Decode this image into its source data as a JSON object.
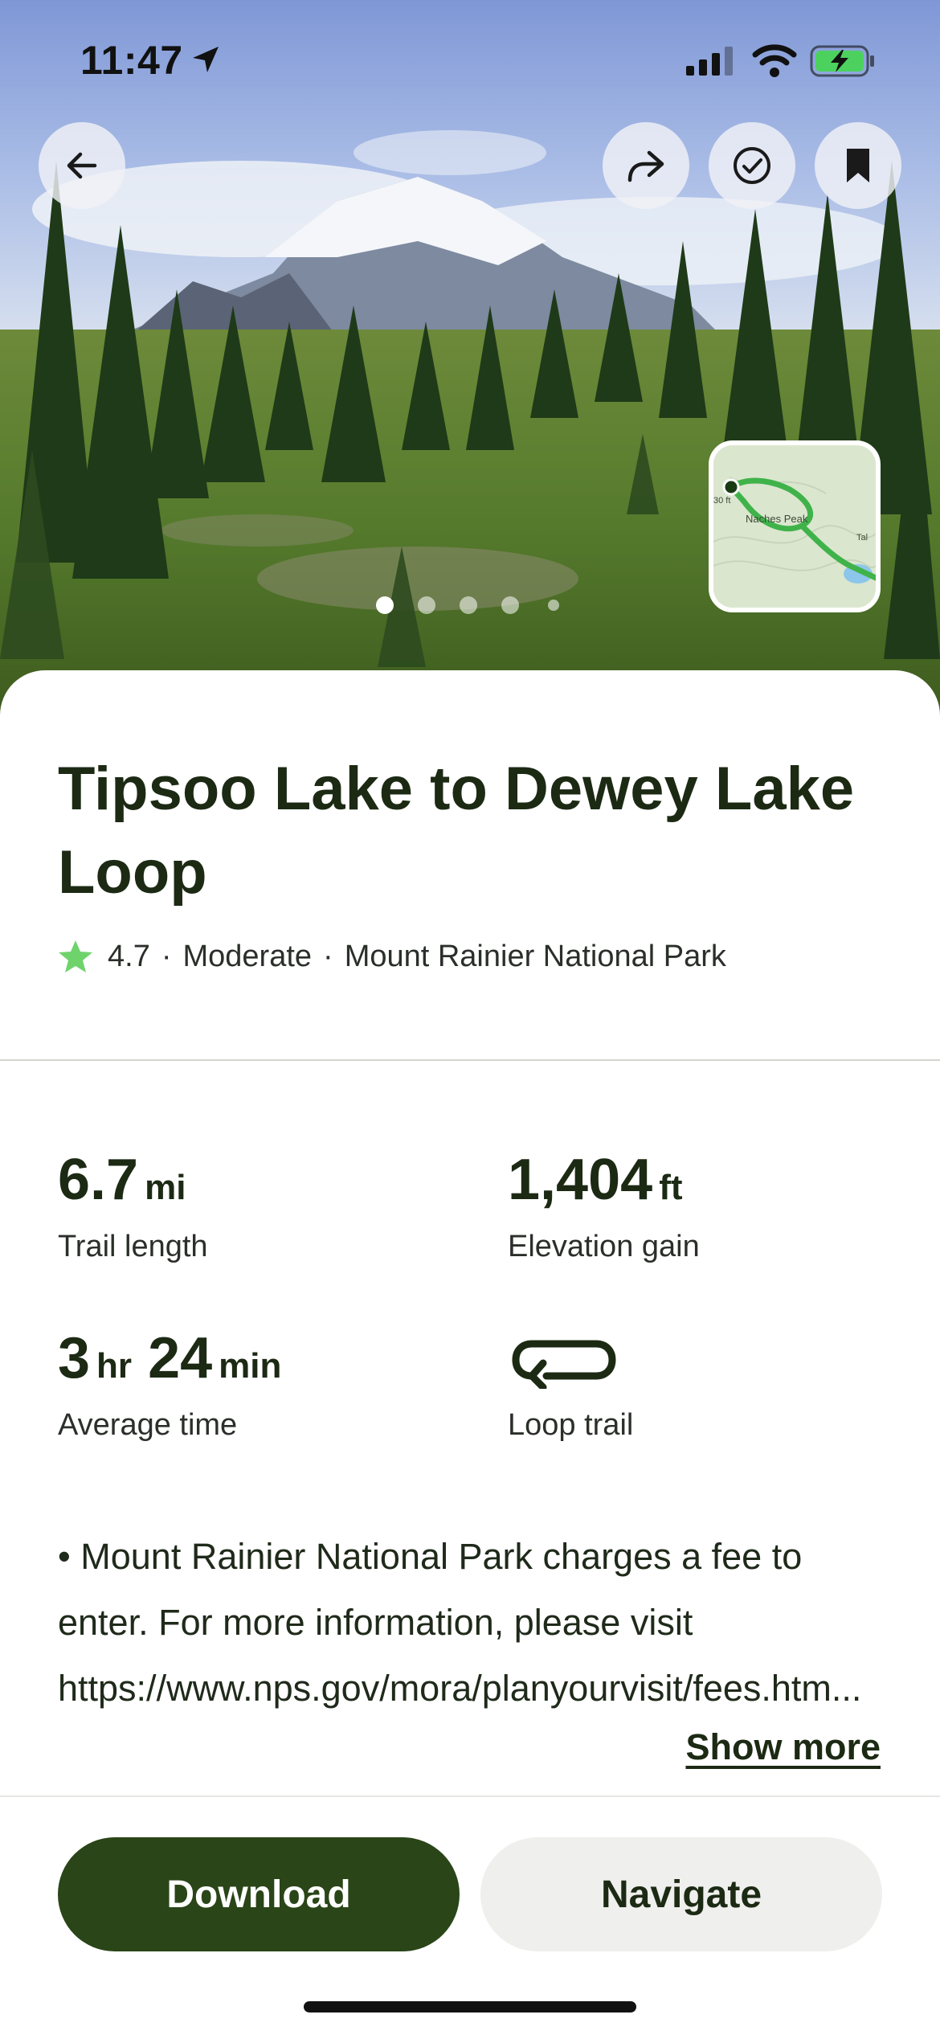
{
  "status_bar": {
    "time": "11:47",
    "icons": [
      "location-arrow-icon",
      "cellular-signal-icon",
      "wifi-icon",
      "battery-charging-icon"
    ]
  },
  "hero": {
    "photo_description_icon": "mountain-photo",
    "photo_count": 5,
    "active_photo_index": 0,
    "buttons": {
      "back": "back-arrow-icon",
      "share": "share-icon",
      "complete": "checkmark-circle-icon",
      "save": "bookmark-icon"
    },
    "map_thumbnail": {
      "label": "Naches Peak",
      "elevation_label": "30 ft",
      "side_label": "Tal"
    }
  },
  "trail": {
    "title": "Tipsoo Lake to Dewey Lake Loop",
    "rating": "4.7",
    "difficulty": "Moderate",
    "park": "Mount Rainier National Park",
    "separator": "·"
  },
  "stats": {
    "length": {
      "value": "6.7",
      "unit": "mi",
      "label": "Trail length"
    },
    "elevation": {
      "value": "1,404",
      "unit": "ft",
      "label": "Elevation gain"
    },
    "time": {
      "hours": "3",
      "hours_unit": "hr",
      "minutes": "24",
      "minutes_unit": "min",
      "label": "Average time"
    },
    "route": {
      "icon": "loop-icon",
      "label": "Loop trail"
    }
  },
  "description": {
    "text": "• Mount Rainier National Park charges a fee to enter. For more information, please visit https://www.nps.gov/mora/planyourvisit/fees.htm...",
    "show_more": "Show more"
  },
  "actions": {
    "download": "Download",
    "navigate": "Navigate"
  },
  "colors": {
    "primary_green": "#2a4518",
    "text_dark": "#1c2a14",
    "star_green": "#6fd36c",
    "map_trail_green": "#3fb34a"
  }
}
